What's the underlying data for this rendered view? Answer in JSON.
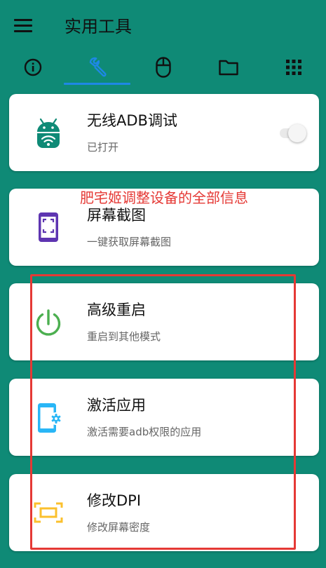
{
  "app": {
    "title": "实用工具"
  },
  "tabs": [
    {
      "name": "info",
      "icon": "info-icon",
      "selected": false
    },
    {
      "name": "tools",
      "icon": "wrench-icon",
      "selected": true
    },
    {
      "name": "mouse",
      "icon": "mouse-icon",
      "selected": false
    },
    {
      "name": "files",
      "icon": "folder-icon",
      "selected": false
    },
    {
      "name": "apps",
      "icon": "grid-icon",
      "selected": false
    }
  ],
  "cards": [
    {
      "title": "无线ADB调试",
      "subtitle": "已打开",
      "icon": "android-wifi-icon",
      "switch_on": false
    },
    {
      "title": "屏幕截图",
      "subtitle": "一键获取屏幕截图",
      "icon": "screenshot-icon"
    },
    {
      "title": "高级重启",
      "subtitle": "重启到其他模式",
      "icon": "power-icon"
    },
    {
      "title": "激活应用",
      "subtitle": "激活需要adb权限的应用",
      "icon": "phone-settings-icon"
    },
    {
      "title": "修改DPI",
      "subtitle": "修改屏幕密度",
      "icon": "dpi-frame-icon"
    }
  ],
  "annotation": {
    "text": "肥宅姬调整设备的全部信息"
  },
  "colors": {
    "background": "#0F8A76",
    "accent": "#1E88E5",
    "card": "#FFFFFF",
    "annotation": "#E53935",
    "android_green": "#0F8A76",
    "screenshot_purple": "#5E35B1",
    "power_green": "#4CAF50",
    "phone_blue": "#29B6F6",
    "dpi_yellow": "#FBC02D"
  }
}
